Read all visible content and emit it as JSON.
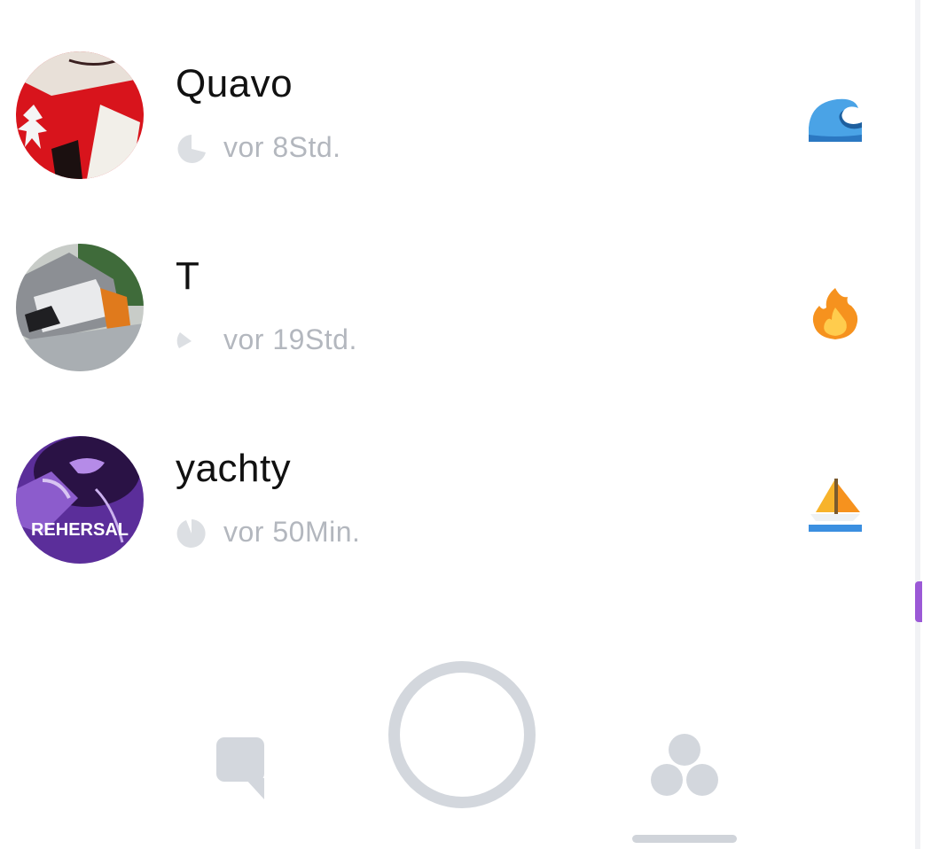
{
  "stories": [
    {
      "name": "Quavo",
      "time": "vor 8Std.",
      "emoji": "wave-icon",
      "avatar_text": ""
    },
    {
      "name": "T",
      "time": "vor 19Std.",
      "emoji": "fire-icon",
      "avatar_text": ""
    },
    {
      "name": "yachty",
      "time": "vor 50Min.",
      "emoji": "sailboat-icon",
      "avatar_text": "REHERSAL"
    }
  ],
  "colors": {
    "name_text": "#111111",
    "time_text": "#b3b7be",
    "icon_gray": "#d3d7dd",
    "scroll_accent": "#9b59d6"
  },
  "nav": {
    "items": [
      "chat-icon",
      "capture-button",
      "stories-icon"
    ],
    "active": "stories-icon"
  }
}
